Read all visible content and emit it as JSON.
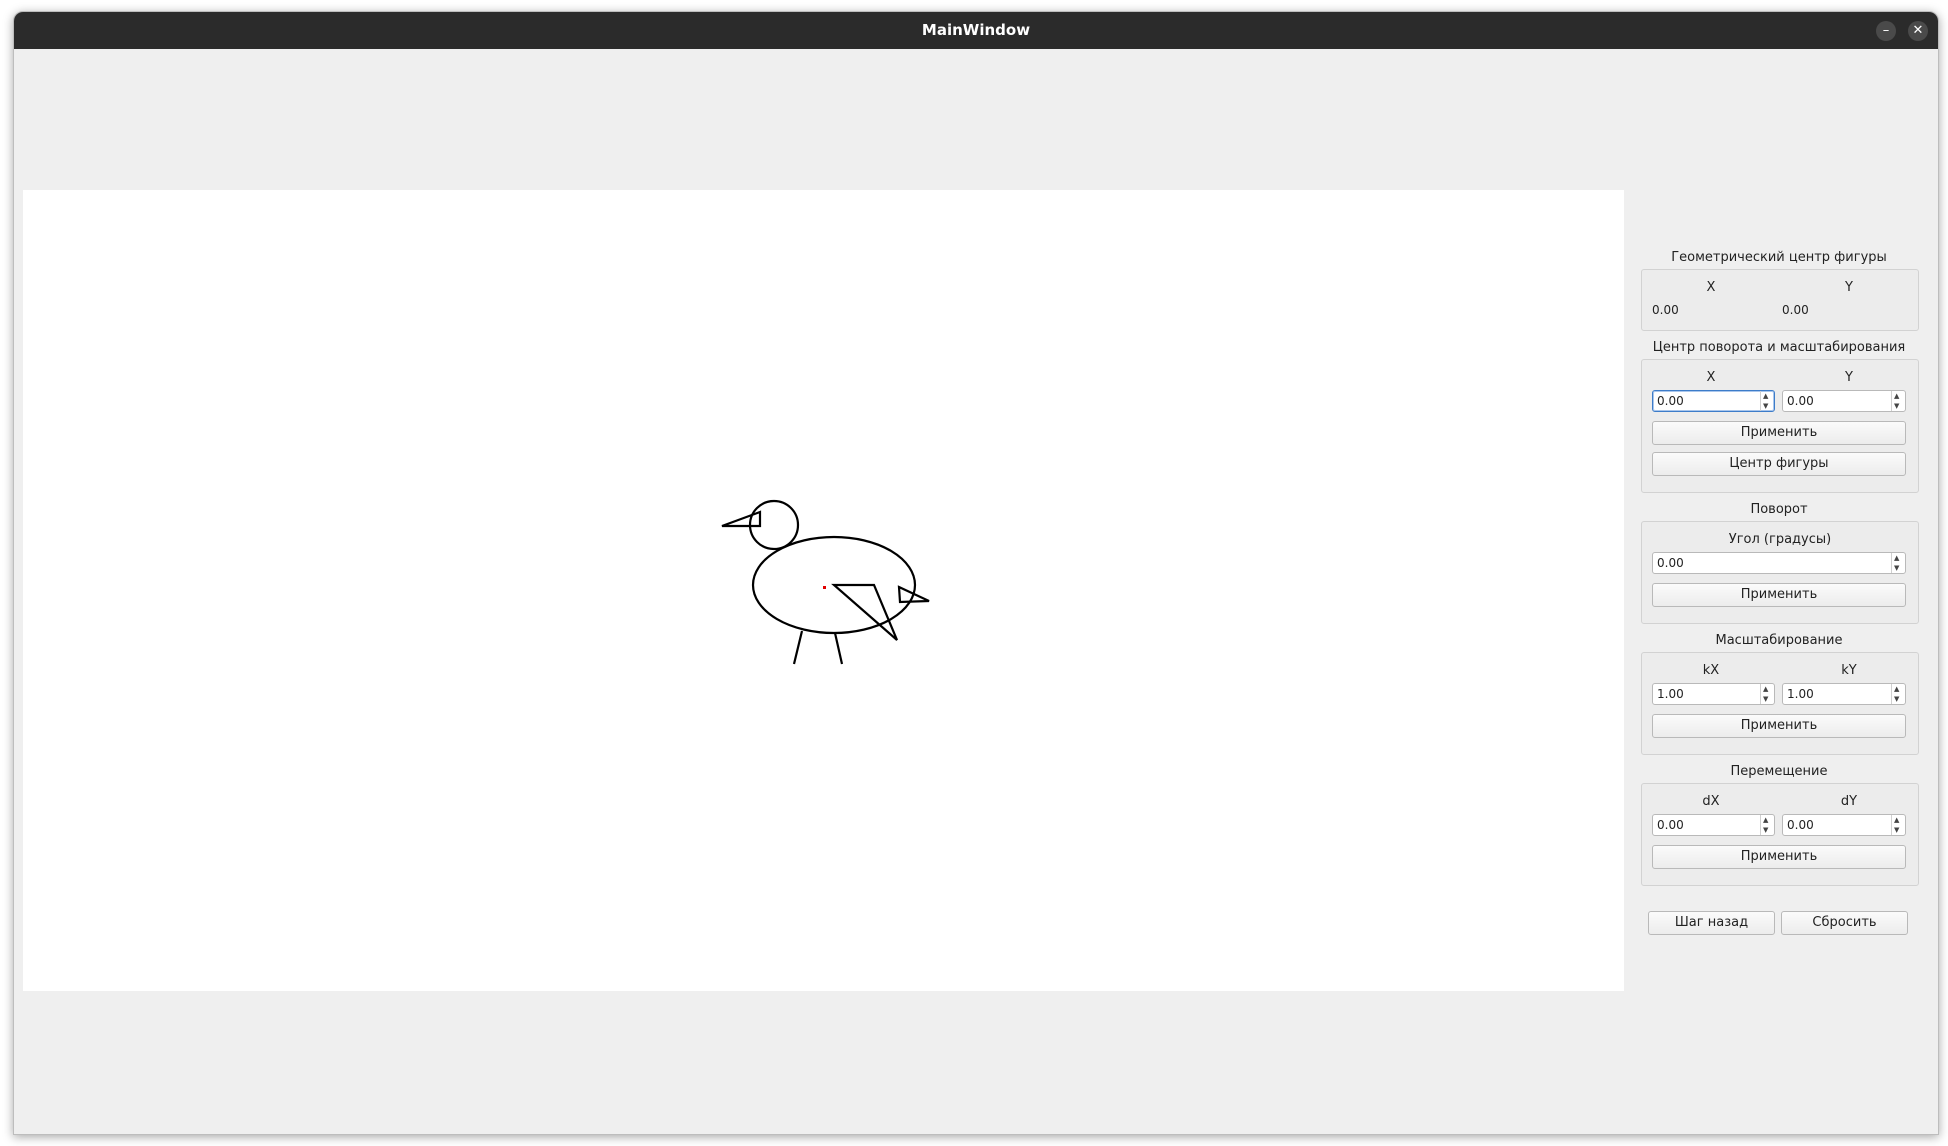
{
  "window": {
    "title": "MainWindow",
    "minimize_glyph": "–",
    "close_glyph": "✕"
  },
  "geom_center": {
    "title": "Геометрический центр фигуры",
    "x_label": "X",
    "y_label": "Y",
    "x_value": "0.00",
    "y_value": "0.00"
  },
  "rotation_center": {
    "title": "Центр поворота и масштабирования",
    "x_label": "X",
    "y_label": "Y",
    "x_value": "0.00",
    "y_value": "0.00",
    "apply_label": "Применить",
    "figure_center_label": "Центр фигуры"
  },
  "rotation": {
    "title": "Поворот",
    "angle_label": "Угол (градусы)",
    "angle_value": "0.00",
    "apply_label": "Применить"
  },
  "scaling": {
    "title": "Масштабирование",
    "kx_label": "kX",
    "ky_label": "kY",
    "kx_value": "1.00",
    "ky_value": "1.00",
    "apply_label": "Применить"
  },
  "translation": {
    "title": "Перемещение",
    "dx_label": "dX",
    "dy_label": "dY",
    "dx_value": "0.00",
    "dy_value": "0.00",
    "apply_label": "Применить"
  },
  "actions": {
    "undo_label": "Шаг назад",
    "reset_label": "Сбросить"
  },
  "colors": {
    "figure_stroke": "#000000",
    "center_point": "#e00000",
    "focus_border": "#3d7cc9"
  },
  "icons": {
    "minimize": "minimize-icon",
    "close": "close-icon",
    "spin_up": "chevron-up-icon",
    "spin_down": "chevron-down-icon"
  }
}
